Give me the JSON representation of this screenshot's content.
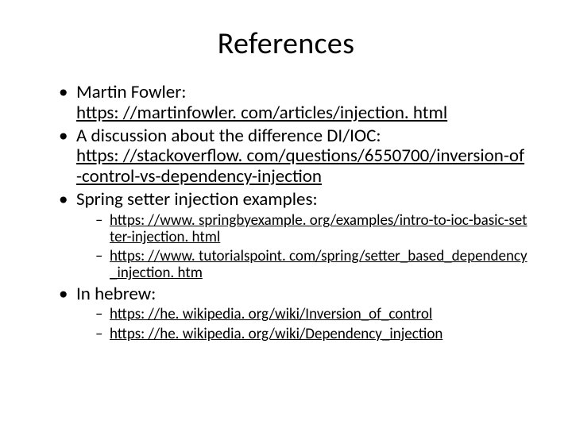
{
  "title": "References",
  "items": [
    {
      "text": "Martin Fowler: ",
      "link": "https: //martinfowler. com/articles/injection. html"
    },
    {
      "text": "A discussion about the difference DI/IOC: ",
      "link": "https: //stackoverflow. com/questions/6550700/inversion-of-control-vs-dependency-injection"
    },
    {
      "text": "Spring setter injection examples:",
      "sub": [
        "https: //www. springbyexample. org/examples/intro-to-ioc-basic-setter-injection. html",
        "https: //www. tutorialspoint. com/spring/setter_based_dependency_injection. htm"
      ]
    },
    {
      "text": "In hebrew:",
      "sub": [
        "https: //he. wikipedia. org/wiki/Inversion_of_control",
        "https: //he. wikipedia. org/wiki/Dependency_injection"
      ]
    }
  ]
}
